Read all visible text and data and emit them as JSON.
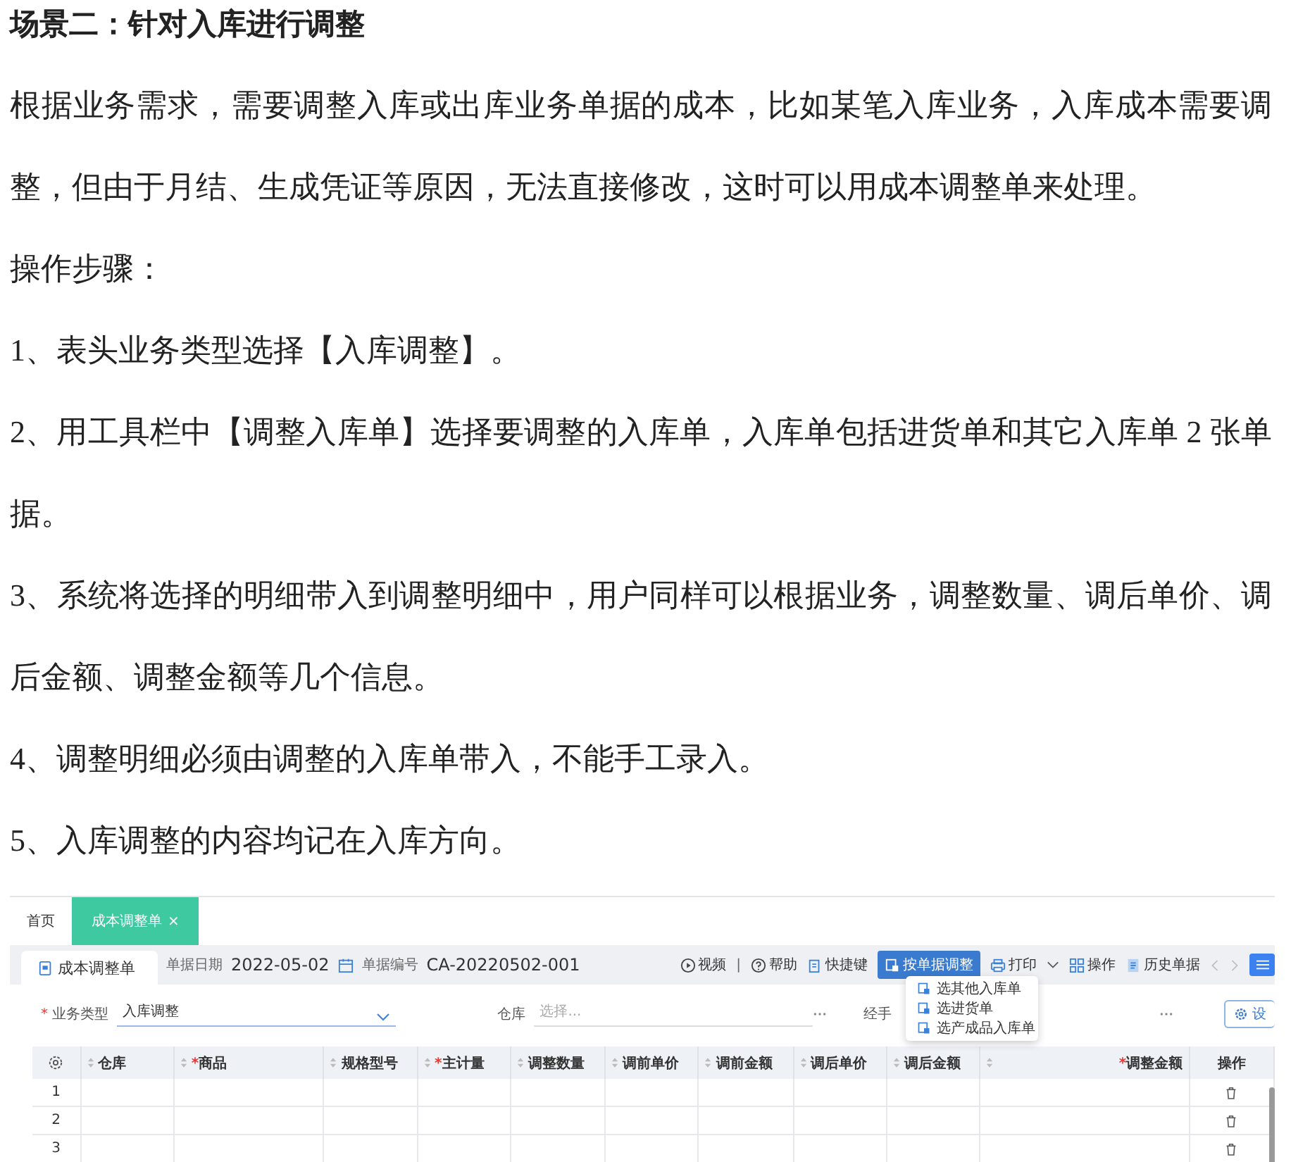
{
  "article": {
    "heading": "场景二：针对入库进行调整",
    "paragraphs": [
      "根据业务需求，需要调整入库或出库业务单据的成本，比如某笔入库业务，入库成本需要调整，但由于月结、生成凭证等原因，无法直接修改，这时可以用成本调整单来处理。",
      "操作步骤：",
      "1、表头业务类型选择【入库调整】。",
      "2、用工具栏中【调整入库单】选择要调整的入库单，入库单包括进货单和其它入库单 2 张单据。",
      "3、系统将选择的明细带入到调整明细中，用户同样可以根据业务，调整数量、调后单价、调后金额、调整金额等几个信息。",
      "4、调整明细必须由调整的入库单带入，不能手工录入。",
      "5、入库调整的内容均记在入库方向。"
    ]
  },
  "app": {
    "tabs": [
      {
        "label": "首页",
        "selected": false,
        "closable": false
      },
      {
        "label": "成本调整单",
        "selected": true,
        "closable": true
      }
    ],
    "close_mark": "×",
    "required_mark": "*",
    "doc_tab": "成本调整单",
    "date_label": "单据日期",
    "date": "2022-05-02",
    "number_label": "单据编号",
    "number": "CA-20220502-001",
    "toolbar": [
      {
        "kind": "link",
        "label": "视频"
      },
      {
        "kind": "separator",
        "label": "|"
      },
      {
        "kind": "link",
        "label": "帮助"
      },
      {
        "kind": "link",
        "label": "快捷键"
      },
      {
        "kind": "primary",
        "label": "按单据调整"
      },
      {
        "kind": "dropdown",
        "label": "打印"
      },
      {
        "kind": "link",
        "label": "操作"
      },
      {
        "kind": "link",
        "label": "历史单据"
      }
    ],
    "form": {
      "type_label": "业务类型",
      "type_required": true,
      "type_value": "入库调整",
      "warehouse_label": "仓库",
      "warehouse_placeholder": "选择...",
      "handler_label": "经手",
      "settings_label": "设"
    },
    "columns": [
      {
        "label": "仓库",
        "required": false,
        "sortable": true
      },
      {
        "label": "商品",
        "required": true,
        "sortable": true
      },
      {
        "label": "规格型号",
        "required": false,
        "sortable": true
      },
      {
        "label": "主计量",
        "required": true,
        "sortable": true
      },
      {
        "label": "调整数量",
        "required": false,
        "sortable": true
      },
      {
        "label": "调前单价",
        "required": false,
        "sortable": true
      },
      {
        "label": "调前金额",
        "required": false,
        "sortable": true
      },
      {
        "label": "调后单价",
        "required": false,
        "sortable": true
      },
      {
        "label": "调后金额",
        "required": false,
        "sortable": true
      },
      {
        "label": "调整金额",
        "required": true,
        "sortable": true
      },
      {
        "label": "操作",
        "required": false,
        "sortable": false
      }
    ],
    "rows": [
      {
        "no": "1"
      },
      {
        "no": "2"
      },
      {
        "no": "3"
      }
    ],
    "menu": [
      {
        "label": "选其他入库单"
      },
      {
        "label": "选进货单"
      },
      {
        "label": "选产成品入库单"
      }
    ]
  }
}
